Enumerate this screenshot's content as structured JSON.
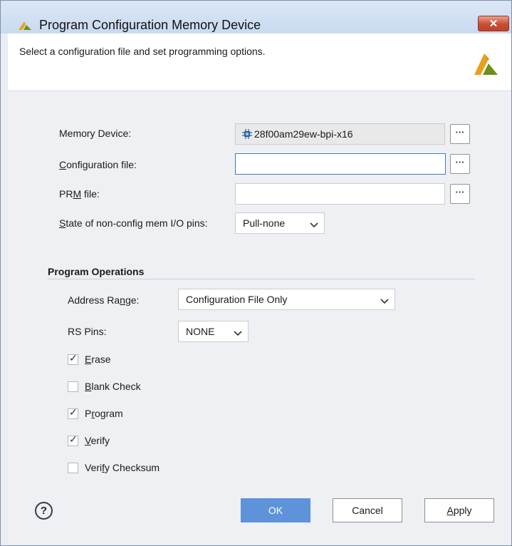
{
  "window": {
    "title": "Program Configuration Memory Device",
    "close_label": "✕",
    "subtitle": "Select a configuration file and set programming options."
  },
  "colors": {
    "brand_logo": "#6d8f1b",
    "title_gradient_top": "#dbe7f6",
    "close_button": "#c74d33",
    "primary_button": "#5f93d9",
    "focus_border": "#3d7bc8"
  },
  "form": {
    "memory_device": {
      "label": "Memory Device:",
      "value": "28f00am29ew-bpi-x16",
      "icon": "chip-icon",
      "browse_label": "···"
    },
    "configuration_file": {
      "label_accel": "C",
      "label_rest": "onfiguration file:",
      "value": "",
      "browse_label": "···"
    },
    "prm_file": {
      "label_pre": "PR",
      "label_accel": "M",
      "label_post": " file:",
      "value": "",
      "browse_label": "···"
    },
    "io_pins": {
      "label_accel": "S",
      "label_rest": "tate of non-config mem I/O pins:",
      "selected": "Pull-none"
    }
  },
  "operations": {
    "title": "Program Operations",
    "address_range": {
      "label_pre": "Address Ra",
      "label_accel": "n",
      "label_post": "ge:",
      "selected": "Configuration File Only"
    },
    "rs_pins": {
      "label": "RS Pins:",
      "selected": "NONE"
    },
    "checkboxes": [
      {
        "label_pre": "",
        "label_accel": "E",
        "label_post": "rase",
        "checked": true
      },
      {
        "label_pre": "",
        "label_accel": "B",
        "label_post": "lank Check",
        "checked": false
      },
      {
        "label_pre": "P",
        "label_accel": "r",
        "label_post": "ogram",
        "checked": true
      },
      {
        "label_pre": "",
        "label_accel": "V",
        "label_post": "erify",
        "checked": true
      },
      {
        "label_pre": "Veri",
        "label_accel": "f",
        "label_post": "y Checksum",
        "checked": false
      }
    ],
    "check_glyph": "✓"
  },
  "footer": {
    "help_label": "?",
    "ok_label": "OK",
    "cancel_label": "Cancel",
    "apply_accel": "A",
    "apply_rest": "pply"
  }
}
